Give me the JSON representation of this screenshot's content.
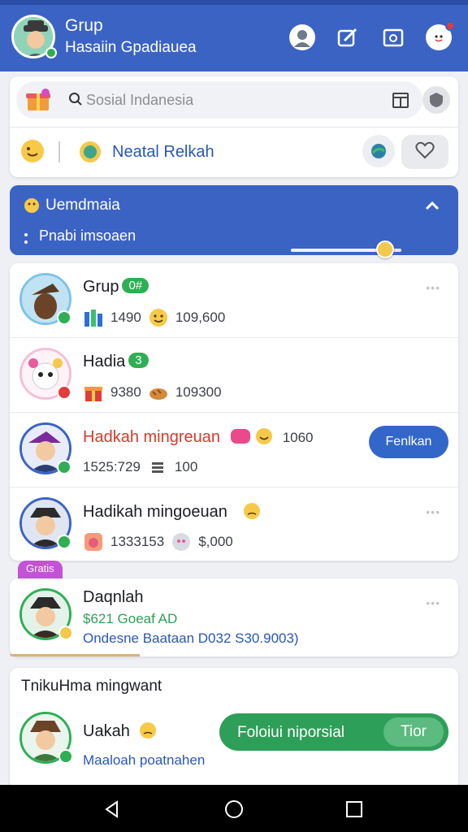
{
  "header": {
    "title": "Grup",
    "subtitle": "Hasaiin Gpadiauea"
  },
  "search": {
    "placeholder": "Sosial Indanesia"
  },
  "quick": {
    "label": "Neatal Relkah"
  },
  "banner": {
    "title": "Uemdmaia",
    "subtitle": "Pnabi imsoaen",
    "progress": 0.85
  },
  "groups": [
    {
      "name": "Grup",
      "tag": "0#",
      "stat1": "1490",
      "stat2": "109,600"
    },
    {
      "name": "Hadia",
      "tag": "3",
      "stat1": "9380",
      "stat2": "109300"
    },
    {
      "name": "Hadkah mingreuan",
      "count": "1060",
      "stat1": "1525:729",
      "stat2": "100",
      "button": "Fenlkan"
    },
    {
      "name": "Hadikah mingoeuan",
      "stat1": "1333153",
      "stat2": "$,000"
    }
  ],
  "featured": {
    "tag": "Gratis",
    "name": "Daqnlah",
    "line1": "$621 Goeaf AD",
    "line2": "Ondesne Baataan D032 S30.9003)"
  },
  "bottom": {
    "section_title": "TnikuHma mingwant",
    "user_name": "Uakah",
    "user_sub": "Maaloah poatnahen",
    "action_label": "Foloiui niporsial",
    "action_sub": "Tior"
  },
  "colors": {
    "primary": "#3b63c4",
    "green": "#2e9f58",
    "accent_red": "#d23b2c"
  },
  "icons": {
    "header": [
      "profile-icon",
      "edit-icon",
      "camera-icon",
      "notification-icon"
    ],
    "system": [
      "back-icon",
      "home-icon",
      "recents-icon"
    ]
  }
}
